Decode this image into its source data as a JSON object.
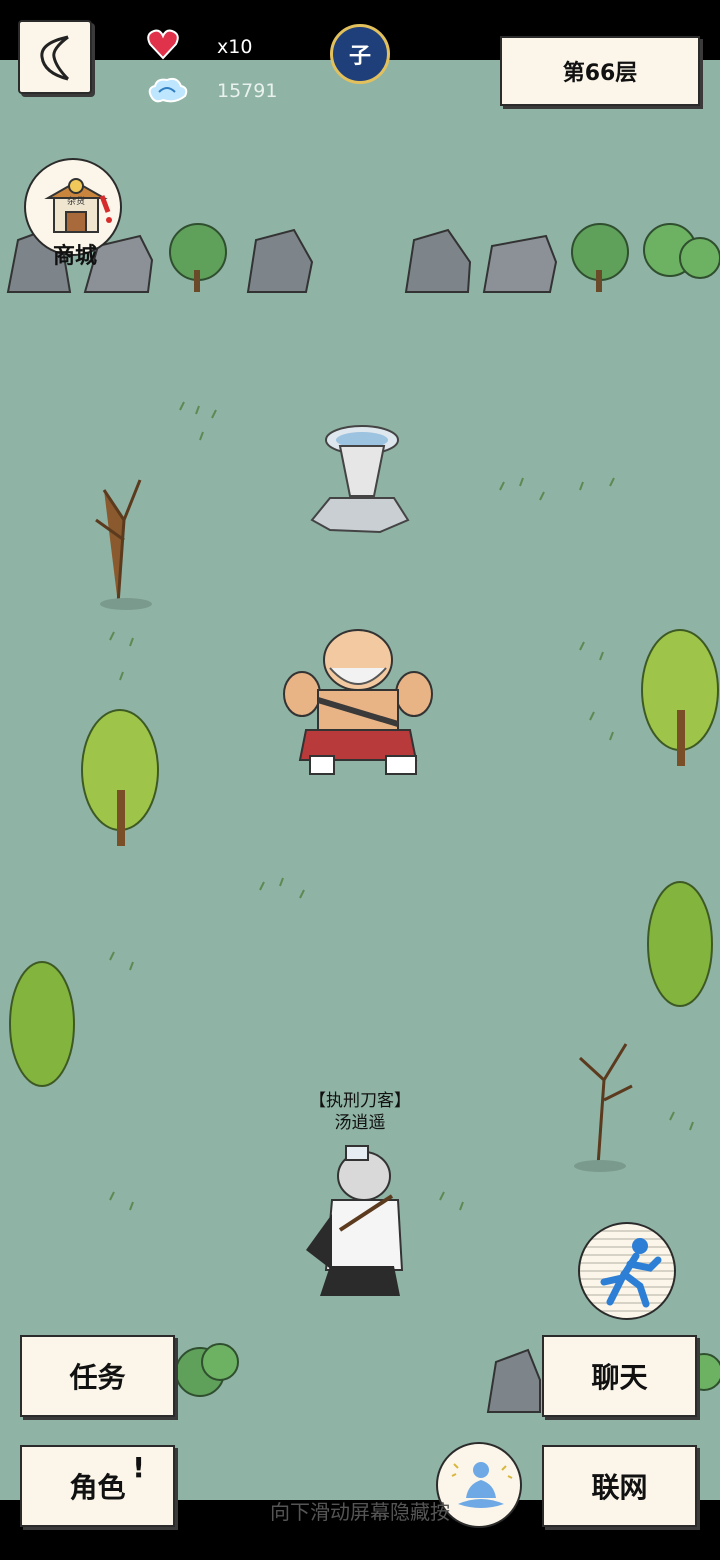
{
  "header": {
    "lives_value": "x10",
    "coins_value": "15791",
    "time_glyph": "子",
    "floor_label": "第66层"
  },
  "shop": {
    "label": "商城",
    "sign": "杂货"
  },
  "player": {
    "title": "【执刑刀客】",
    "name": "汤逍遥"
  },
  "buttons": {
    "quest": "任务",
    "role": "角色",
    "chat": "聊天",
    "online": "联网"
  },
  "hint": "向下滑动屏幕隐藏按",
  "icons": {
    "back": "chevron-left-icon",
    "lives": "heart-icon",
    "coins": "cloud-coin-icon",
    "run": "running-man-icon",
    "meditate": "meditation-icon"
  },
  "colors": {
    "ground": "#8fb3a5",
    "panel": "#fbf6e9"
  }
}
